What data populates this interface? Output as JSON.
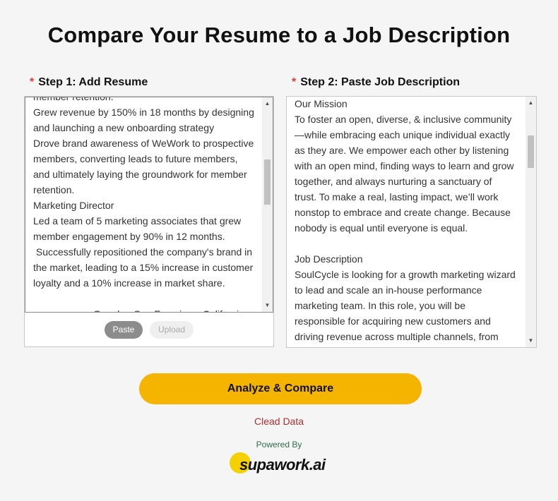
{
  "page": {
    "title": "Compare Your Resume to a Job Description"
  },
  "step1": {
    "required_mark": "*",
    "label": "Step 1: Add Resume",
    "resume_lines": [
      "member retention.",
      "Grew revenue by 150% in 18 months by designing",
      "and launching a new onboarding strategy",
      "Drove brand awareness of WeWork to prospective",
      "members, converting leads to future members,",
      "and ultimately laying the groundwork for member",
      "retention.",
      "Marketing Director",
      "Led a team of 5 marketing associates that grew",
      "member engagement by 90% in 12 months.",
      " Successfully repositioned the company's brand in",
      "the market, leading to a 15% increase in customer",
      "loyalty and a 10% increase in market share.",
      "",
      "Google - San Francisco, California"
    ],
    "paste_label": "Paste",
    "upload_label": "Upload"
  },
  "step2": {
    "required_mark": "*",
    "label": "Step 2: Paste Job Description",
    "jd_lines": [
      "Our Mission",
      "To foster an open, diverse, & inclusive community",
      "—while embracing each unique individual exactly",
      "as they are. We empower each other by listening",
      "with an open mind, finding ways to learn and grow",
      "together, and always nurturing a sanctuary of",
      "trust. To make a real, lasting impact, we’ll work",
      "nonstop to embrace and create change. Because",
      "nobody is equal until everyone is equal.",
      "",
      "Job Description",
      "SoulCycle is looking for a growth marketing wizard",
      "to lead and scale an in-house performance",
      "marketing team. In this role, you will be",
      "responsible for acquiring new customers and",
      "driving revenue across multiple channels, from"
    ]
  },
  "actions": {
    "analyze_label": "Analyze & Compare",
    "clear_label": "Clead Data"
  },
  "footer": {
    "powered_by": "Powered By",
    "logo_text": "supawork.ai"
  },
  "colors": {
    "accent": "#f5b400",
    "required": "#e53935",
    "clear_link": "#b03030",
    "powered_by": "#2f6b4f"
  },
  "icons": {
    "scroll_up": "triangle-up",
    "scroll_down": "triangle-down"
  }
}
